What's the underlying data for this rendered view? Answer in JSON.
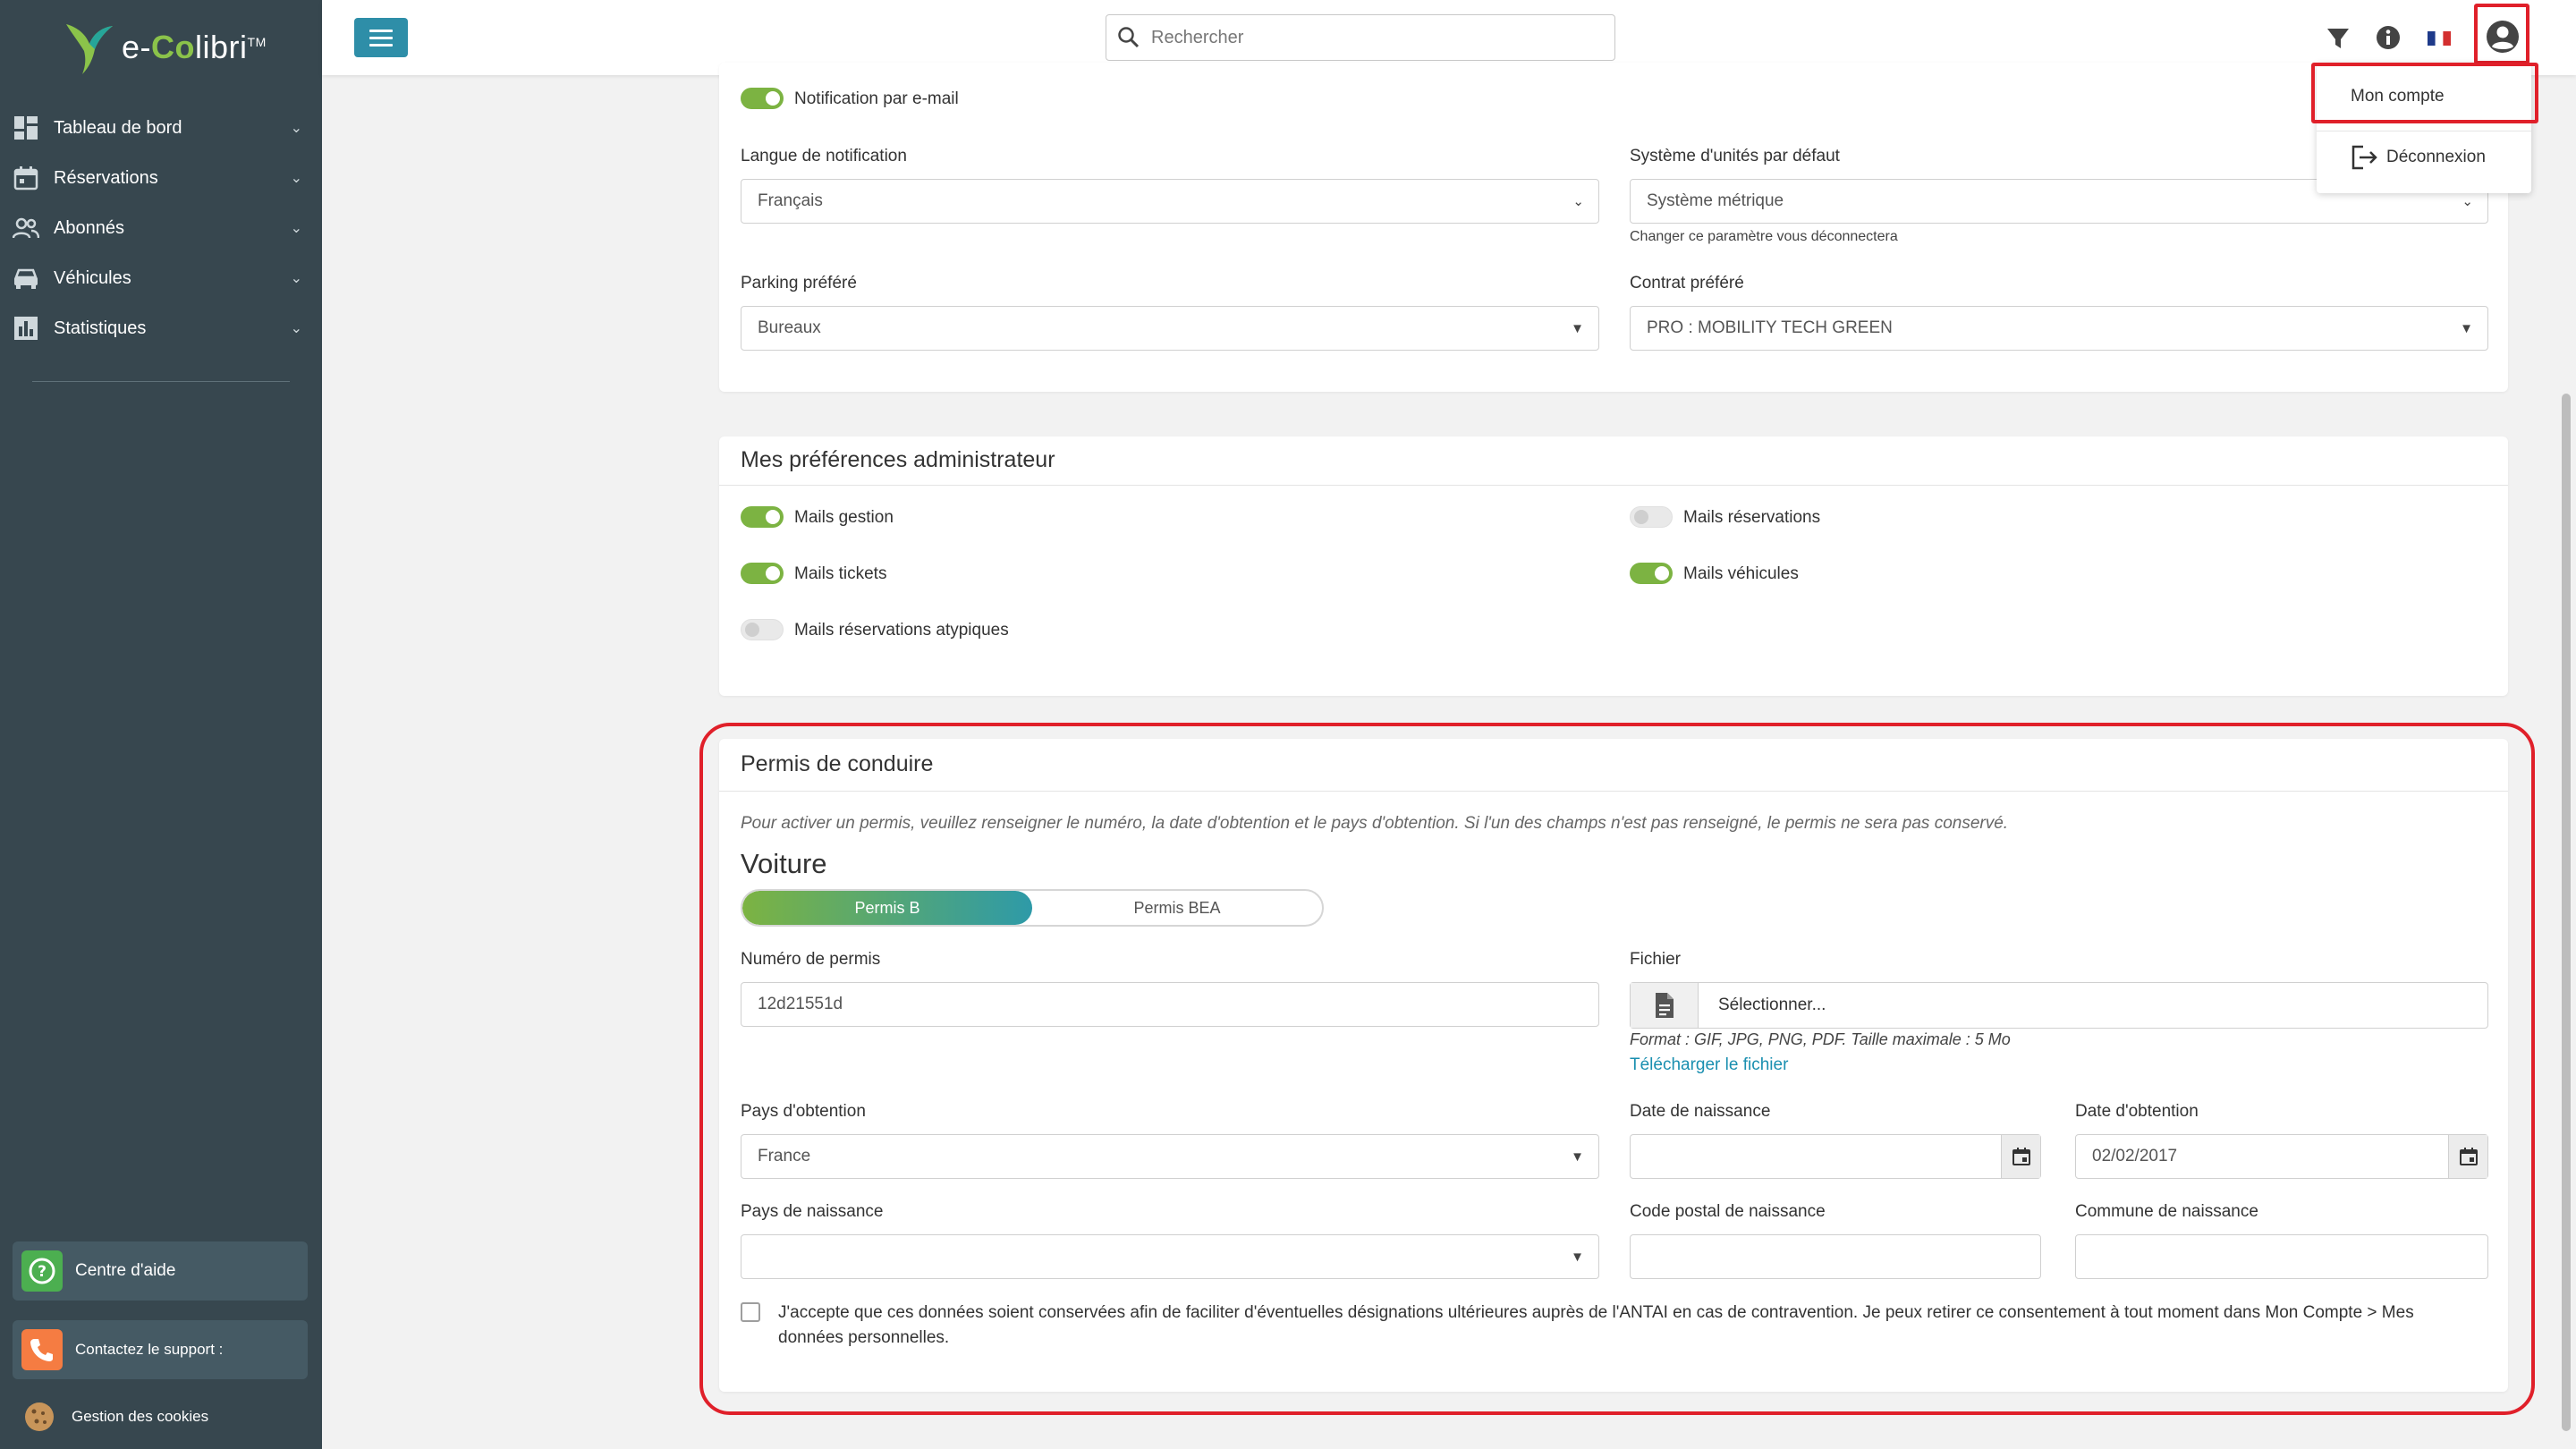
{
  "sidebar": {
    "logo": {
      "prefix": "e-",
      "brand": "Co",
      "suffix": "libri",
      "tm": "TM"
    },
    "items": [
      {
        "label": "Tableau de bord",
        "icon": "dashboard-icon"
      },
      {
        "label": "Réservations",
        "icon": "calendar-icon"
      },
      {
        "label": "Abonnés",
        "icon": "users-icon"
      },
      {
        "label": "Véhicules",
        "icon": "car-icon"
      },
      {
        "label": "Statistiques",
        "icon": "chart-icon"
      }
    ],
    "help_label": "Centre d'aide",
    "support_label": "Contactez le support :",
    "cookies_label": "Gestion des cookies"
  },
  "topbar": {
    "search_placeholder": "Rechercher",
    "icons": [
      "filter-icon",
      "info-icon",
      "french-flag-icon",
      "account-icon"
    ]
  },
  "account_menu": {
    "items": [
      "Mon compte",
      "Déconnexion"
    ]
  },
  "user_prefs": {
    "email_notification_label": "Notification par e-mail",
    "email_notification_on": true,
    "lang_label": "Langue de notification",
    "lang_value": "Français",
    "units_label": "Système d'unités par défaut",
    "units_value": "Système métrique",
    "units_hint": "Changer ce paramètre vous déconnectera",
    "parking_label": "Parking préféré",
    "parking_value": "Bureaux",
    "contract_label": "Contrat préféré",
    "contract_value": "PRO : MOBILITY TECH GREEN"
  },
  "admin_prefs": {
    "title": "Mes préférences administrateur",
    "toggles": [
      {
        "label": "Mails gestion",
        "on": true
      },
      {
        "label": "Mails réservations",
        "on": false
      },
      {
        "label": "Mails tickets",
        "on": true
      },
      {
        "label": "Mails véhicules",
        "on": true
      },
      {
        "label": "Mails réservations atypiques",
        "on": false
      }
    ]
  },
  "license": {
    "title": "Permis de conduire",
    "info": "Pour activer un permis, veuillez renseigner le numéro, la date d'obtention et le pays d'obtention. Si l'un des champs n'est pas renseigné, le permis ne sera pas conservé.",
    "subtitle": "Voiture",
    "tabs": [
      "Permis B",
      "Permis BEA"
    ],
    "number_label": "Numéro de permis",
    "number_value": "12d21551d",
    "file_label": "Fichier",
    "file_button": "Sélectionner...",
    "file_format": "Format : GIF, JPG, PNG, PDF. Taille maximale : 5 Mo",
    "file_download": "Télécharger le fichier",
    "country_label": "Pays d'obtention",
    "country_value": "France",
    "birthdate_label": "Date de naissance",
    "birthdate_value": "",
    "obtained_label": "Date d'obtention",
    "obtained_value": "02/02/2017",
    "birth_country_label": "Pays de naissance",
    "birth_country_value": "",
    "birth_postal_label": "Code postal de naissance",
    "birth_postal_value": "",
    "birth_city_label": "Commune de naissance",
    "birth_city_value": "",
    "consent_text": "J'accepte que ces données soient conservées afin de faciliter d'éventuelles désignations ultérieures auprès de l'ANTAI en cas de contravention. Je peux retirer ce consentement à tout moment dans Mon Compte > Mes données personnelles."
  },
  "colors": {
    "sidebar": "#37474f",
    "accent": "#2e8ea8",
    "toggle_on": "#7cb342",
    "highlight": "#e0202a",
    "link": "#1a8fb0"
  }
}
